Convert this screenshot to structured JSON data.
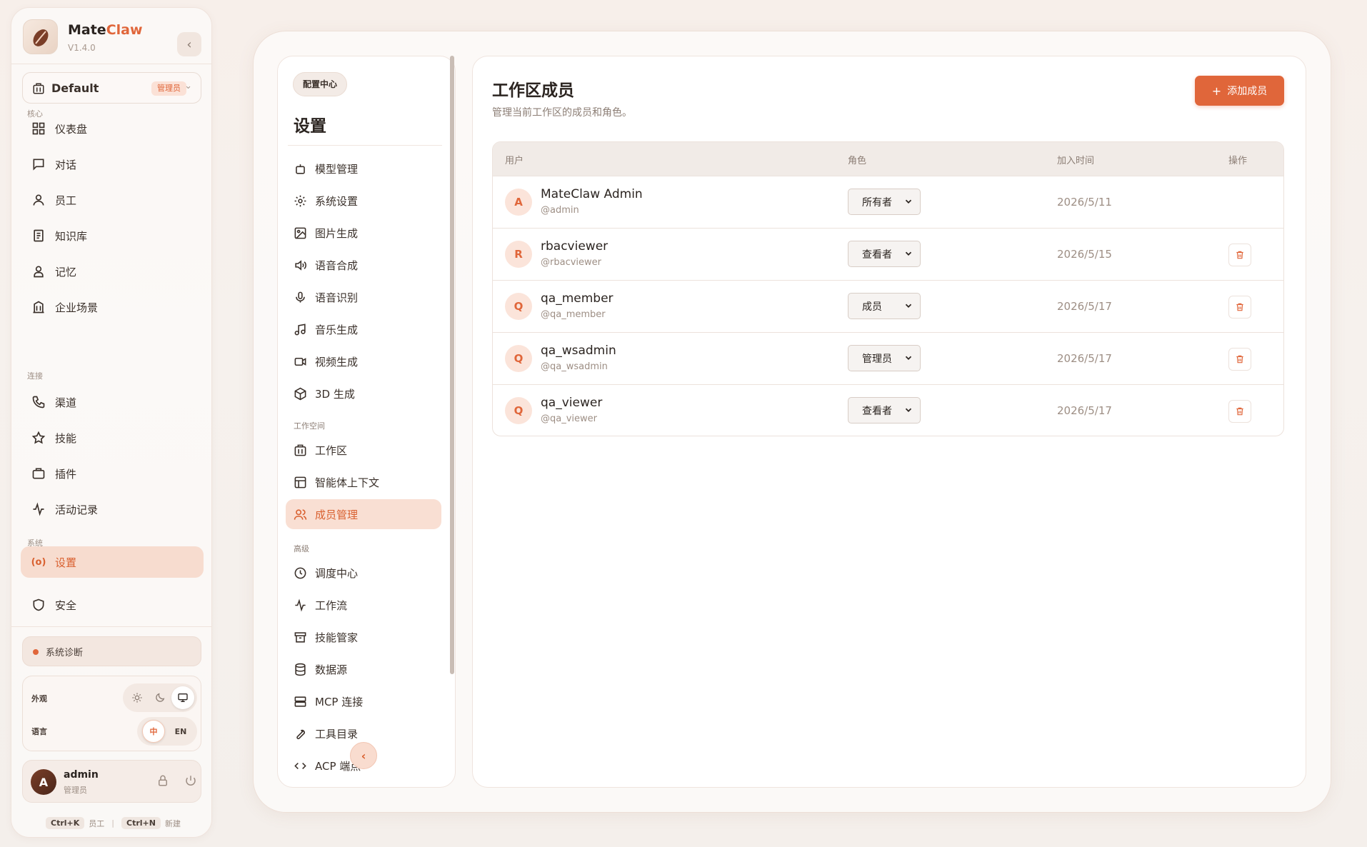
{
  "brand": {
    "name_main": "Mate",
    "name_accent": "Claw",
    "version": "V1.4.0"
  },
  "workspace": {
    "name": "Default",
    "badge": "管理员"
  },
  "nav": {
    "sections": {
      "core": "核心",
      "connect": "连接",
      "system": "系统"
    },
    "items": [
      {
        "label": "仪表盘",
        "icon": "dashboard-icon"
      },
      {
        "label": "对话",
        "icon": "chat-icon"
      },
      {
        "label": "员工",
        "icon": "user-icon"
      },
      {
        "label": "知识库",
        "icon": "book-icon"
      },
      {
        "label": "记忆",
        "icon": "memory-icon"
      },
      {
        "label": "企业场景",
        "icon": "building-icon"
      },
      {
        "label": "渠道",
        "icon": "phone-icon"
      },
      {
        "label": "技能",
        "icon": "star-icon"
      },
      {
        "label": "插件",
        "icon": "briefcase-icon"
      },
      {
        "label": "活动记录",
        "icon": "activity-icon"
      },
      {
        "label": "设置",
        "icon": "settings-icon",
        "active": true
      },
      {
        "label": "安全",
        "icon": "shield-icon"
      }
    ]
  },
  "diagnostics": {
    "label": "系统诊断"
  },
  "prefs": {
    "appearance_label": "外观",
    "language_label": "语言",
    "lang_zh": "中",
    "lang_en": "EN"
  },
  "user": {
    "name": "admin",
    "role": "管理员",
    "avatar_letter": "A"
  },
  "shortcuts": [
    {
      "key": "Ctrl+K",
      "label": "员工"
    },
    {
      "key": "Ctrl+N",
      "label": "新建"
    }
  ],
  "settings": {
    "badge": "配置中心",
    "title": "设置",
    "section_workspace": "工作空间",
    "section_advanced": "高级",
    "items": [
      {
        "label": "模型管理",
        "icon": "robot-icon"
      },
      {
        "label": "系统设置",
        "icon": "gear-icon"
      },
      {
        "label": "图片生成",
        "icon": "image-icon"
      },
      {
        "label": "语音合成",
        "icon": "speaker-icon"
      },
      {
        "label": "语音识别",
        "icon": "microphone-icon"
      },
      {
        "label": "音乐生成",
        "icon": "music-icon"
      },
      {
        "label": "视频生成",
        "icon": "video-icon"
      },
      {
        "label": "3D 生成",
        "icon": "cube-icon"
      },
      {
        "label": "工作区",
        "icon": "workspace-icon"
      },
      {
        "label": "智能体上下文",
        "icon": "layout-icon"
      },
      {
        "label": "成员管理",
        "icon": "users-icon",
        "active": true
      },
      {
        "label": "调度中心",
        "icon": "clock-icon"
      },
      {
        "label": "工作流",
        "icon": "workflow-icon"
      },
      {
        "label": "技能管家",
        "icon": "archive-icon"
      },
      {
        "label": "数据源",
        "icon": "database-icon"
      },
      {
        "label": "MCP 连接",
        "icon": "server-icon"
      },
      {
        "label": "工具目录",
        "icon": "wrench-icon"
      },
      {
        "label": "ACP 端点",
        "icon": "code-icon"
      }
    ]
  },
  "page": {
    "title": "工作区成员",
    "subtitle": "管理当前工作区的成员和角色。",
    "add_button": "添加成员",
    "columns": [
      "用户",
      "角色",
      "加入时间",
      "操作"
    ],
    "members": [
      {
        "letter": "A",
        "name": "MateClaw Admin",
        "handle": "@admin",
        "role": "所有者",
        "joined": "2026/5/11",
        "deletable": false
      },
      {
        "letter": "R",
        "name": "rbacviewer",
        "handle": "@rbacviewer",
        "role": "查看者",
        "joined": "2026/5/15",
        "deletable": true
      },
      {
        "letter": "Q",
        "name": "qa_member",
        "handle": "@qa_member",
        "role": "成员",
        "joined": "2026/5/17",
        "deletable": true
      },
      {
        "letter": "Q",
        "name": "qa_wsadmin",
        "handle": "@qa_wsadmin",
        "role": "管理员",
        "joined": "2026/5/17",
        "deletable": true
      },
      {
        "letter": "Q",
        "name": "qa_viewer",
        "handle": "@qa_viewer",
        "role": "查看者",
        "joined": "2026/5/17",
        "deletable": true
      }
    ]
  },
  "colors": {
    "accent": "#e0663a",
    "active_bg": "#f7dccf"
  }
}
